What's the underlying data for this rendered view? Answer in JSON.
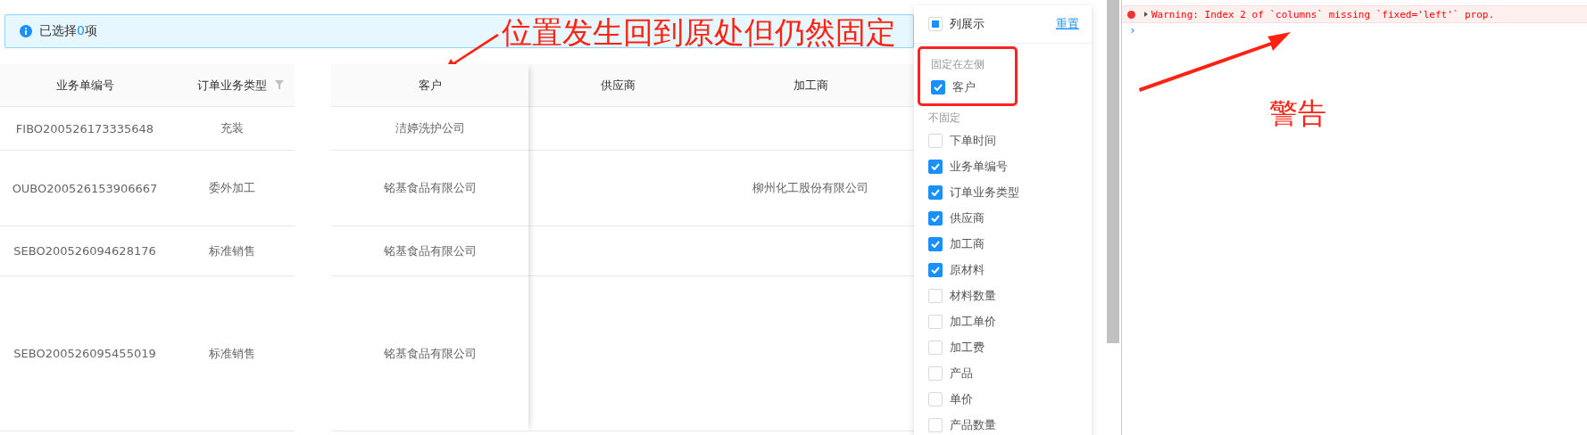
{
  "selection_alert": {
    "prefix": "已选择",
    "count": "0",
    "suffix": "项"
  },
  "table": {
    "columns": [
      {
        "label": "业务单编号",
        "filter": false
      },
      {
        "label": "订单业务类型",
        "filter": true
      },
      {
        "label": "客户",
        "filter": false
      },
      {
        "label": "供应商",
        "filter": false
      },
      {
        "label": "加工商",
        "filter": false
      }
    ],
    "rows": [
      {
        "order_number": "FIBO200526173335648",
        "order_type": "充装",
        "customer": "洁婷洗护公司"
      },
      {
        "order_number": "OUBO200526153906667",
        "order_type": "委外加工",
        "customer": "铭基食品有限公司",
        "processor": "柳州化工股份有限公司"
      },
      {
        "order_number": "SEBO200526094628176",
        "order_type": "标准销售",
        "customer": "铭基食品有限公司"
      },
      {
        "order_number": "SEBO200526095455019",
        "order_type": "标准销售",
        "customer": "铭基食品有限公司"
      }
    ]
  },
  "column_menu": {
    "title": "列展示",
    "checked": false,
    "indeterminate": true,
    "reset_link": "重置",
    "groups": [
      {
        "heading": "固定在左侧",
        "highlighted": true,
        "items": [
          {
            "label": "客户",
            "checked": true
          }
        ]
      },
      {
        "heading": "不固定",
        "highlighted": false,
        "items": [
          {
            "label": "下单时间",
            "checked": false
          },
          {
            "label": "业务单编号",
            "checked": true
          },
          {
            "label": "订单业务类型",
            "checked": true
          },
          {
            "label": "供应商",
            "checked": true
          },
          {
            "label": "加工商",
            "checked": true
          },
          {
            "label": "原材料",
            "checked": true
          },
          {
            "label": "材料数量",
            "checked": false
          },
          {
            "label": "加工单价",
            "checked": false
          },
          {
            "label": "加工费",
            "checked": false
          },
          {
            "label": "产品",
            "checked": false
          },
          {
            "label": "单价",
            "checked": false
          },
          {
            "label": "产品数量",
            "checked": false
          }
        ]
      }
    ]
  },
  "console": {
    "messages": [
      {
        "text": "Warning: Index 2 of `columns` missing `fixed='left'` prop."
      }
    ],
    "prompt": "›"
  },
  "annotations": [
    {
      "text": "位置发生回到原处但仍然固定"
    },
    {
      "text": "警告"
    }
  ]
}
